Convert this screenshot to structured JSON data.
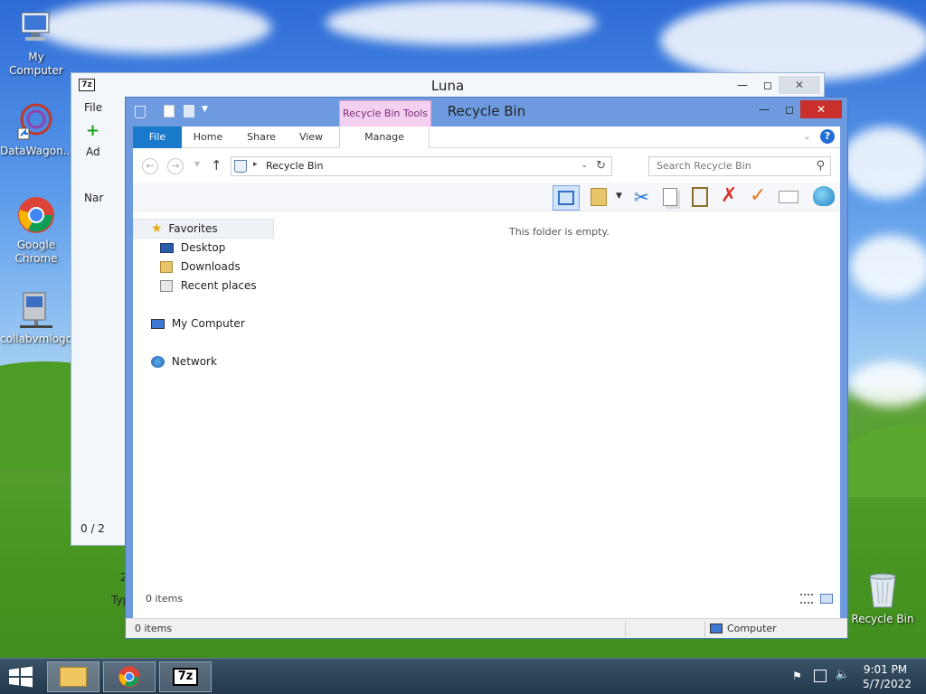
{
  "desktop": {
    "icons": [
      {
        "label": "My Computer"
      },
      {
        "label": "DataWagon..."
      },
      {
        "label": "Google Chrome"
      },
      {
        "label": "collabvmlogo"
      },
      {
        "label": "Recycle Bin"
      }
    ]
  },
  "luna_window": {
    "title": "Luna",
    "partial_labels": [
      "File",
      "Ad",
      "Nar",
      "0 / 2",
      "2",
      "Typ"
    ]
  },
  "recycle_window": {
    "title": "Recycle Bin",
    "context_tab": "Recycle Bin Tools",
    "tabs": [
      "File",
      "Home",
      "Share",
      "View"
    ],
    "context_subtab": "Manage",
    "address": "Recycle Bin",
    "search_placeholder": "Search Recycle Bin",
    "empty_message": "This folder is empty.",
    "nav": {
      "favorites": "Favorites",
      "favorites_items": [
        "Desktop",
        "Downloads",
        "Recent places"
      ],
      "computer": "My Computer",
      "network": "Network"
    },
    "status_count": "0 items",
    "status_bar_count": "0 items",
    "status_bar_location": "Computer"
  },
  "taskbar": {
    "time": "9:01 PM",
    "date": "5/7/2022",
    "pinned": [
      "File Explorer",
      "Google Chrome",
      "7-Zip"
    ]
  },
  "colors": {
    "file_tab": "#1979ca",
    "context_tab": "#f4d0f0",
    "close_button": "#c9302c",
    "window_frame": "#6e9be0"
  }
}
